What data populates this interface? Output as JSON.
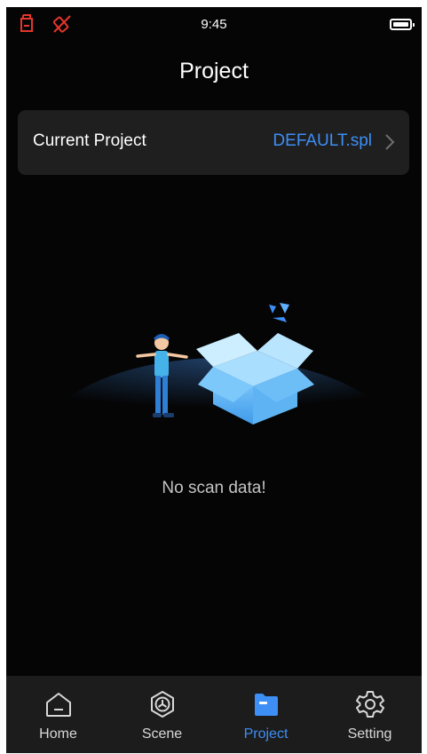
{
  "status_bar": {
    "time": "9:45",
    "icons": [
      "sd-card-icon",
      "screen-rotation-icon",
      "battery-icon"
    ],
    "alert_color": "#e5352b"
  },
  "header": {
    "title": "Project"
  },
  "current_project": {
    "label": "Current Project",
    "value": "DEFAULT.spl",
    "value_color": "#3d8ef5"
  },
  "empty_state": {
    "message": "No scan data!",
    "illustration": "person-with-open-box-illustration"
  },
  "tabs": [
    {
      "label": "Home",
      "icon": "home-icon",
      "active": false
    },
    {
      "label": "Scene",
      "icon": "scene-icon",
      "active": false
    },
    {
      "label": "Project",
      "icon": "folder-icon",
      "active": true
    },
    {
      "label": "Setting",
      "icon": "gear-icon",
      "active": false
    }
  ],
  "colors": {
    "background": "#050505",
    "card": "#1f1f1f",
    "accent": "#3d8ef5",
    "tabbar": "#1c1c1c"
  }
}
